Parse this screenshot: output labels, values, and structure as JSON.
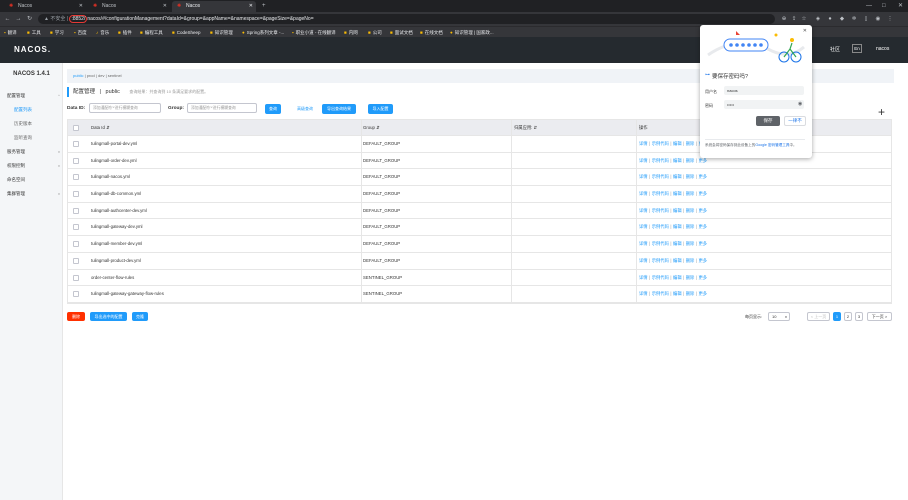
{
  "browser": {
    "tabs": [
      {
        "title": "Nacos",
        "active": false
      },
      {
        "title": "Nacos",
        "active": false
      },
      {
        "title": "Nacos",
        "active": true
      }
    ],
    "url_prefix": "不安全 |",
    "url_host": "",
    "url_port": ":8852/",
    "url_path": "nacos/#/configurationManagement?dataId=&group=&appName=&namespace=&pageSize=&pageNo=",
    "bookmarks": [
      "翻译",
      "工具",
      "学习",
      "百度",
      "音乐",
      "插件",
      "编程工具",
      "CodeSheep",
      "知识管理",
      "Spring系列文章 -...",
      "职业小道 - 在线翻译",
      "内网",
      "公司",
      "面试文档",
      "在线文档",
      "知识管理 | 国家政..."
    ]
  },
  "header": {
    "logo": "NACOS.",
    "links": [
      "社区"
    ],
    "lang": "En",
    "user": "nacos"
  },
  "sidebar": {
    "version": "NACOS 1.4.1",
    "items": [
      {
        "label": "配置管理",
        "sub": false,
        "active": false,
        "caret": true
      },
      {
        "label": "配置列表",
        "sub": true,
        "active": true,
        "caret": false
      },
      {
        "label": "历史版本",
        "sub": true,
        "active": false,
        "caret": false
      },
      {
        "label": "监听查询",
        "sub": true,
        "active": false,
        "caret": false
      },
      {
        "label": "服务管理",
        "sub": false,
        "active": false,
        "caret": true
      },
      {
        "label": "权限控制",
        "sub": false,
        "active": false,
        "caret": true
      },
      {
        "label": "命名空间",
        "sub": false,
        "active": false,
        "caret": false
      },
      {
        "label": "集群管理",
        "sub": false,
        "active": false,
        "caret": true
      }
    ]
  },
  "namespaces": [
    "public",
    "prod",
    "dev",
    "sentinel"
  ],
  "page": {
    "title": "配置管理",
    "sep": "|",
    "namespace": "public",
    "desc": "查询结果：共查询到 10 条满足要求的配置。"
  },
  "search": {
    "dataid_label": "Data ID:",
    "dataid_placeholder": "添加通配符'*'进行模糊查询",
    "group_label": "Group:",
    "group_placeholder": "添加通配符'*'进行模糊查询",
    "query_btn": "查询",
    "advanced_btn": "高级查询",
    "export_btn": "导出查询结果",
    "import_btn": "导入配置"
  },
  "table": {
    "headers": [
      "Data Id",
      "Group",
      "归属应用:",
      "操作"
    ],
    "ops": [
      "详情",
      "示例代码",
      "编辑",
      "删除",
      "更多"
    ],
    "rows": [
      {
        "dataId": "tulingmall-portal-dev.yml",
        "group": "DEFAULT_GROUP"
      },
      {
        "dataId": "tulingmall-order-dev.yml",
        "group": "DEFAULT_GROUP"
      },
      {
        "dataId": "tulingmall-nacos.yml",
        "group": "DEFAULT_GROUP"
      },
      {
        "dataId": "tulingmall-db-common.yml",
        "group": "DEFAULT_GROUP"
      },
      {
        "dataId": "tulingmall-authcenter-dev.yml",
        "group": "DEFAULT_GROUP"
      },
      {
        "dataId": "tulingmall-gateway-dev.yml",
        "group": "DEFAULT_GROUP"
      },
      {
        "dataId": "tulingmall-member-dev.yml",
        "group": "DEFAULT_GROUP"
      },
      {
        "dataId": "tulingmall-product-dev.yml",
        "group": "DEFAULT_GROUP"
      },
      {
        "dataId": "order-center-flow-rules",
        "group": "SENTINEL_GROUP"
      },
      {
        "dataId": "tulingmall-gateway-gateway-flow-rules",
        "group": "SENTINEL_GROUP"
      }
    ]
  },
  "footer": {
    "delete_btn": "删除",
    "export_selected_btn": "导出选中的配置",
    "clone_btn": "克隆",
    "page_size_label": "每页显示:",
    "page_size": "10",
    "prev": "< 上一页",
    "pages": [
      "1",
      "2",
      "3"
    ],
    "current_page": "1",
    "next": "下一页 >"
  },
  "password_popup": {
    "question": "要保存密码吗?",
    "username_label": "用户名",
    "username_value": "nacos",
    "password_label": "密码",
    "password_value": "•••••",
    "save_btn": "保存",
    "never_btn": "一律不",
    "note_prefix": "系统会将密码保存到此设备上的",
    "note_link": "Google 密码管理工具",
    "note_suffix": "中。"
  },
  "colors": {
    "accent": "#209bfa",
    "danger": "#ff3000",
    "header": "#252a2f"
  }
}
